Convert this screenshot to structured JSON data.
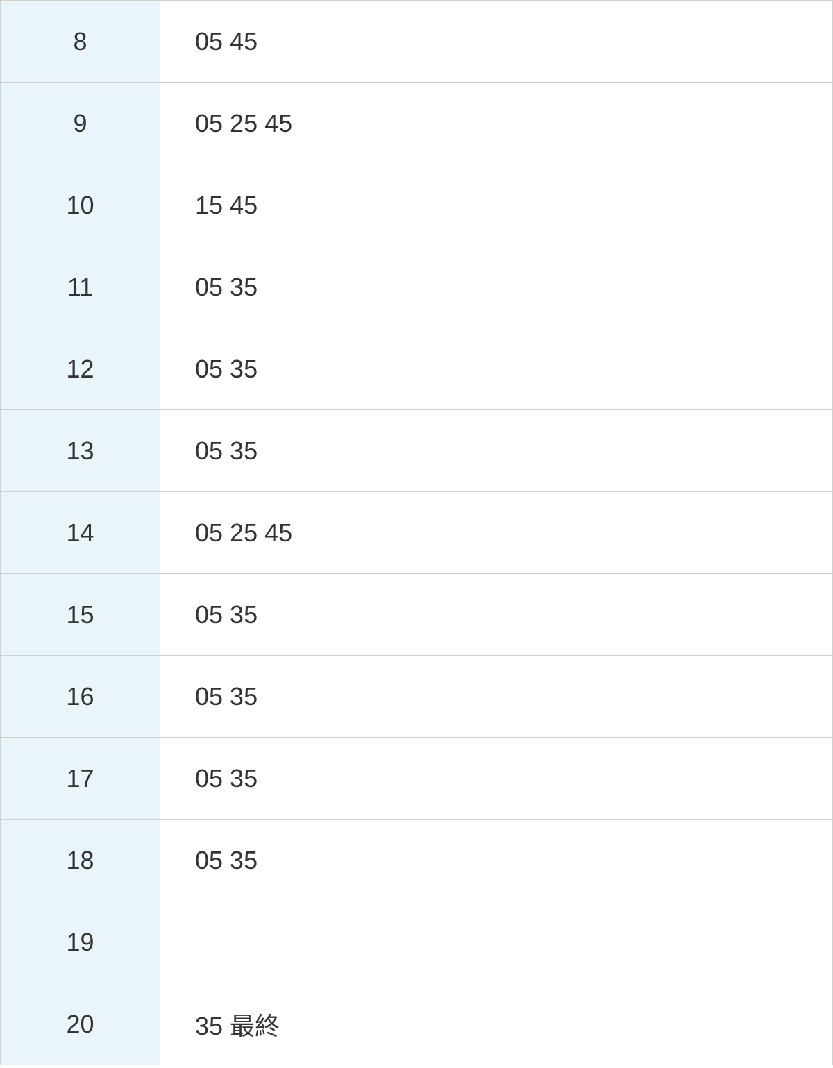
{
  "timetable": {
    "rows": [
      {
        "hour": "8",
        "minutes": "05 45"
      },
      {
        "hour": "9",
        "minutes": "05 25 45"
      },
      {
        "hour": "10",
        "minutes": "15 45"
      },
      {
        "hour": "11",
        "minutes": "05 35"
      },
      {
        "hour": "12",
        "minutes": "05 35"
      },
      {
        "hour": "13",
        "minutes": "05 35"
      },
      {
        "hour": "14",
        "minutes": "05 25 45"
      },
      {
        "hour": "15",
        "minutes": "05 35"
      },
      {
        "hour": "16",
        "minutes": "05 35"
      },
      {
        "hour": "17",
        "minutes": "05 35"
      },
      {
        "hour": "18",
        "minutes": "05 35"
      },
      {
        "hour": "19",
        "minutes": ""
      },
      {
        "hour": "20",
        "minutes": "35 最終"
      }
    ]
  }
}
